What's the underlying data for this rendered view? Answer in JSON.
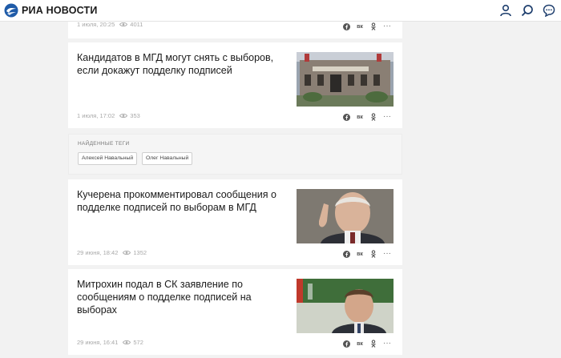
{
  "header": {
    "logo_text": "РИА НОВОСТИ",
    "icons": [
      "user-icon",
      "search-icon",
      "chat-icon"
    ]
  },
  "feed": {
    "partial_card": {
      "date": "1 июля, 20:25",
      "views": "4011"
    },
    "articles": [
      {
        "title": "Кандидатов в МГД могут снять с выборов, если докажут подделку подписей",
        "date": "1 июля, 17:02",
        "views": "353",
        "image": "building-photo"
      },
      {
        "title": "Кучерена прокомментировал сообщения о подделке подписей по выборам в МГД",
        "date": "29 июня, 18:42",
        "views": "1352",
        "image": "portrait-photo"
      },
      {
        "title": "Митрохин подал в СК заявление по сообщениям о подделке подписей на выборах",
        "date": "29 июня, 16:41",
        "views": "572",
        "image": "portrait-photo"
      }
    ],
    "tags_block": {
      "title": "НАЙДЕННЫЕ ТЕГИ",
      "tags": [
        "Алексей Навальный",
        "Олег Навальный"
      ]
    },
    "share_icons": [
      "facebook-icon",
      "vk-icon",
      "odnoklassniki-icon",
      "more-icon"
    ],
    "share_vk_label": "вк",
    "share_more_label": "···"
  },
  "colors": {
    "accent": "#1f5ba8",
    "text": "#1a1a1a",
    "meta": "#a8a8a8",
    "background": "#f2f2f2"
  }
}
